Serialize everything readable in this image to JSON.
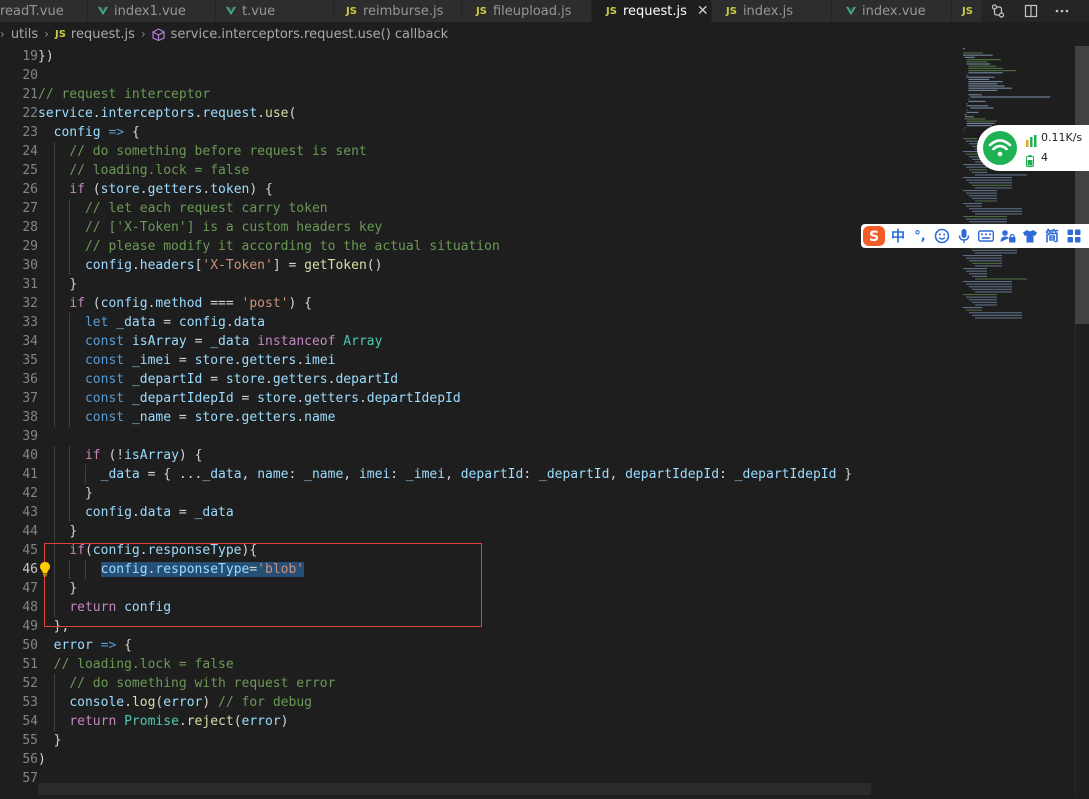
{
  "tabs": [
    {
      "label": "readT.vue",
      "kind": "vue"
    },
    {
      "label": "index1.vue",
      "kind": "vue"
    },
    {
      "label": "t.vue",
      "kind": "vue"
    },
    {
      "label": "reimburse.js",
      "kind": "js"
    },
    {
      "label": "fileupload.js",
      "kind": "js"
    },
    {
      "label": "request.js",
      "kind": "js",
      "active": true
    },
    {
      "label": "index.js",
      "kind": "js"
    },
    {
      "label": "index.vue",
      "kind": "vue"
    },
    {
      "label": "JS",
      "kind": "js-overflow"
    }
  ],
  "breadcrumb": {
    "folder": "utils",
    "file_badge": "JS",
    "file": "request.js",
    "symbol": "service.interceptors.request.use() callback"
  },
  "colors": {
    "keyword": "#c586c0",
    "variable": "#9cdcfe",
    "comment": "#6a9955",
    "string": "#ce9178",
    "function": "#dcdcaa",
    "type": "#4ec9b0",
    "declaration": "#569cd6",
    "highlight_box": "#e04040",
    "selection": "#264f78"
  },
  "editor": {
    "active_line": "46",
    "lines": [
      {
        "num": "19",
        "text": "})"
      },
      {
        "num": "20",
        "text": ""
      },
      {
        "num": "21",
        "text": "// request interceptor"
      },
      {
        "num": "22",
        "text": "service.interceptors.request.use("
      },
      {
        "num": "23",
        "text": "  config => {"
      },
      {
        "num": "24",
        "text": "    // do something before request is sent"
      },
      {
        "num": "25",
        "text": "    // loading.lock = false"
      },
      {
        "num": "26",
        "text": "    if (store.getters.token) {"
      },
      {
        "num": "27",
        "text": "      // let each request carry token"
      },
      {
        "num": "28",
        "text": "      // ['X-Token'] is a custom headers key"
      },
      {
        "num": "29",
        "text": "      // please modify it according to the actual situation"
      },
      {
        "num": "30",
        "text": "      config.headers['X-Token'] = getToken()"
      },
      {
        "num": "31",
        "text": "    }"
      },
      {
        "num": "32",
        "text": "    if (config.method === 'post') {"
      },
      {
        "num": "33",
        "text": "      let _data = config.data"
      },
      {
        "num": "34",
        "text": "      const isArray = _data instanceof Array"
      },
      {
        "num": "35",
        "text": "      const _imei = store.getters.imei"
      },
      {
        "num": "36",
        "text": "      const _departId = store.getters.departId"
      },
      {
        "num": "37",
        "text": "      const _departIdepId = store.getters.departIdepId"
      },
      {
        "num": "38",
        "text": "      const _name = store.getters.name"
      },
      {
        "num": "39",
        "text": ""
      },
      {
        "num": "40",
        "text": "      if (!isArray) {"
      },
      {
        "num": "41",
        "text": "        _data = { ..._data, name: _name, imei: _imei, departId: _departId, departIdepId: _departIdepId }"
      },
      {
        "num": "42",
        "text": "      }"
      },
      {
        "num": "43",
        "text": "      config.data = _data"
      },
      {
        "num": "44",
        "text": "    }"
      },
      {
        "num": "45",
        "text": "    if(config.responseType){"
      },
      {
        "num": "46",
        "text": "        config.responseType='blob'"
      },
      {
        "num": "47",
        "text": "    }"
      },
      {
        "num": "48",
        "text": "    return config"
      },
      {
        "num": "49",
        "text": "  },"
      },
      {
        "num": "50",
        "text": "  error => {"
      },
      {
        "num": "51",
        "text": "  // loading.lock = false"
      },
      {
        "num": "52",
        "text": "    // do something with request error"
      },
      {
        "num": "53",
        "text": "    console.log(error) // for debug"
      },
      {
        "num": "54",
        "text": "    return Promise.reject(error)"
      },
      {
        "num": "55",
        "text": "  }"
      },
      {
        "num": "56",
        "text": ")"
      },
      {
        "num": "57",
        "text": ""
      }
    ]
  },
  "net_widget": {
    "speed": "0.11K/s",
    "count": "4"
  },
  "ime_toolbar": {
    "logo": "S",
    "items": [
      "中",
      "°,",
      "☺",
      "mic-icon",
      "keyboard-icon",
      "lock-icon",
      "shirt-icon",
      "简",
      "grid-icon"
    ]
  }
}
